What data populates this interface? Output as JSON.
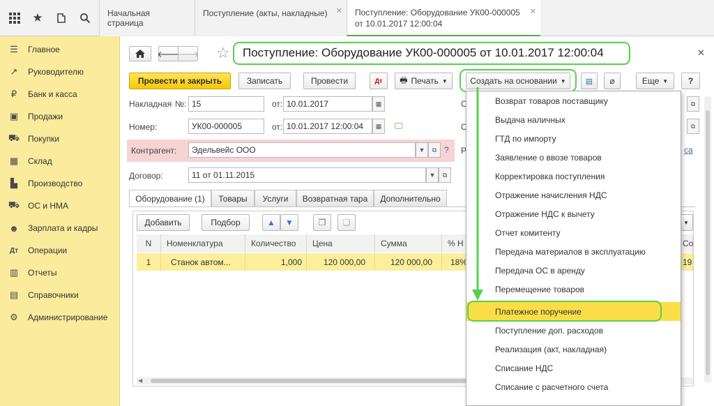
{
  "topbar": {
    "icons": [
      "grid-icon",
      "star-icon",
      "history-icon",
      "search-icon"
    ],
    "tabs": [
      {
        "label": "Начальная страница"
      },
      {
        "label": "Поступление (акты, накладные)"
      },
      {
        "label": "Поступление: Оборудование УК00-000005",
        "label2": "от 10.01.2017 12:00:04"
      }
    ]
  },
  "sidebar": {
    "items": [
      {
        "label": "Главное",
        "icon": "☰"
      },
      {
        "label": "Руководителю",
        "icon": "↗"
      },
      {
        "label": "Банк и касса",
        "icon": "₽"
      },
      {
        "label": "Продажи",
        "icon": "▣"
      },
      {
        "label": "Покупки",
        "icon": "⛟"
      },
      {
        "label": "Склад",
        "icon": "▦"
      },
      {
        "label": "Производство",
        "icon": "▙"
      },
      {
        "label": "ОС и НМА",
        "icon": "⛟"
      },
      {
        "label": "Зарплата и кадры",
        "icon": "☻"
      },
      {
        "label": "Операции",
        "icon": "Дт"
      },
      {
        "label": "Отчеты",
        "icon": "▥"
      },
      {
        "label": "Справочники",
        "icon": "▤"
      },
      {
        "label": "Администрирование",
        "icon": "⚙"
      }
    ]
  },
  "form": {
    "title": "Поступление: Оборудование УК00-000005 от 10.01.2017 12:00:04",
    "toolbar": {
      "post_close": "Провести и закрыть",
      "save": "Записать",
      "post": "Провести",
      "print": "Печать",
      "create_based": "Создать на основании",
      "more": "Еще",
      "help": "?"
    },
    "fields": {
      "invoice_label": "Накладная",
      "no_label": "№:",
      "invoice_no": "15",
      "from_label": "от:",
      "invoice_date": "10.01.2017",
      "number_label": "Номер:",
      "number": "УК00-000005",
      "doc_date": "10.01.2017 12:00:04",
      "counterparty_label": "Контрагент:",
      "counterparty": "Эдельвейс ООО",
      "contract_label": "Договор:",
      "contract": "11 от 01.11.2015",
      "help_mark": "?"
    },
    "subtabs": [
      "Оборудование (1)",
      "Товары",
      "Услуги",
      "Возвратная тара",
      "Дополнительно"
    ],
    "table_buttons": {
      "add": "Добавить",
      "select": "Подбор"
    },
    "table": {
      "headers": [
        "N",
        "Номенклатура",
        "Количество",
        "Цена",
        "Сумма",
        "% Н"
      ],
      "rows": [
        [
          "1",
          "Станок автом...",
          "1,000",
          "120 000,00",
          "120 000,00",
          "18%"
        ]
      ]
    },
    "right_partial": {
      "c1": "С",
      "c2": "С",
      "r": "Р",
      "link": "са"
    }
  },
  "dropdown": {
    "items": [
      "Возврат товаров поставщику",
      "Выдача наличных",
      "ГТД по импорту",
      "Заявление о ввозе товаров",
      "Корректировка поступления",
      "Отражение начисления НДС",
      "Отражение НДС к вычету",
      "Отчет комитенту",
      "Передача материалов в эксплуатацию",
      "Передача ОС в аренду",
      "Перемещение товаров",
      "Платежное поручение",
      "Поступление доп. расходов",
      "Реализация (акт, накладная)",
      "Списание НДС",
      "Списание с расчетного счета"
    ],
    "selected_index": 11
  },
  "colors": {
    "accent_green": "#55d24a",
    "sidebar_bg": "#fbeb9c",
    "selected": "#fbde47",
    "primary_button": "#f6c800"
  }
}
